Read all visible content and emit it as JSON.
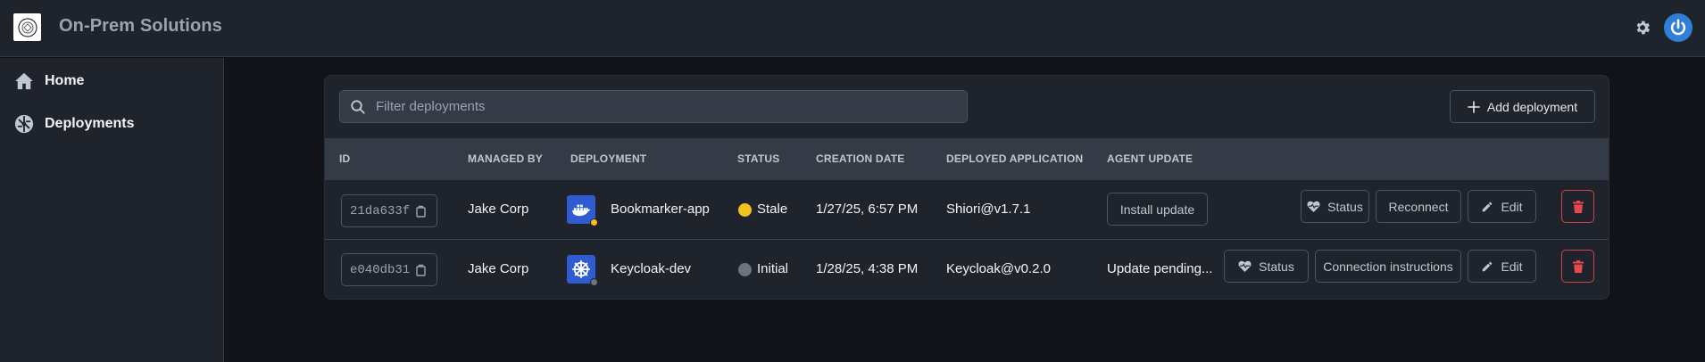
{
  "header": {
    "brand": "On-Prem Solutions",
    "logo_icon": "logo-icon",
    "settings_icon": "gear-icon",
    "power_icon": "power-icon"
  },
  "sidebar": {
    "items": [
      {
        "label": "Home",
        "icon": "home-icon"
      },
      {
        "label": "Deployments",
        "icon": "deployments-icon"
      }
    ]
  },
  "toolbar": {
    "search_placeholder": "Filter deployments",
    "add_label": "Add deployment"
  },
  "table": {
    "columns": [
      "ID",
      "MANAGED BY",
      "DEPLOYMENT",
      "STATUS",
      "CREATION DATE",
      "DEPLOYED APPLICATION",
      "AGENT UPDATE"
    ],
    "rows": [
      {
        "id": "21da633f",
        "managed_by": "Jake Corp",
        "deployment": "Bookmarker-app",
        "deployment_icon": "docker-icon",
        "status": "Stale",
        "status_color": "#f4c01e",
        "creation_date": "1/27/25, 6:57 PM",
        "application": "Shiori@v1.7.1",
        "agent_update": "Install update",
        "status_btn": "Status",
        "secondary_btn": "Reconnect",
        "edit_btn": "Edit"
      },
      {
        "id": "e040db31",
        "managed_by": "Jake Corp",
        "deployment": "Keycloak-dev",
        "deployment_icon": "kubernetes-icon",
        "status": "Initial",
        "status_color": "#6b7280",
        "creation_date": "1/28/25, 4:38 PM",
        "application": "Keycloak@v0.2.0",
        "agent_update": "Update pending...",
        "status_btn": "Status",
        "secondary_btn": "Connection instructions",
        "edit_btn": "Edit"
      }
    ]
  },
  "colors": {
    "accent": "#2f7fd8",
    "danger": "#e5484d",
    "deployment_icon_bg": "#2f5bd3"
  }
}
